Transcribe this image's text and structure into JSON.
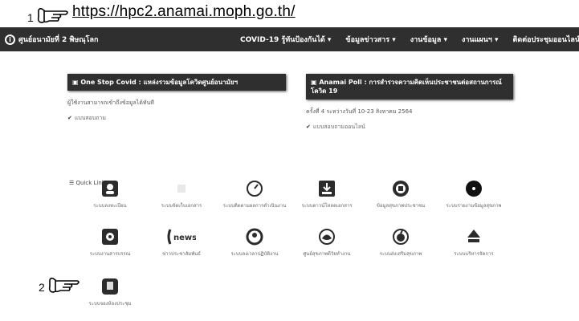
{
  "annotations": {
    "callout1": "1",
    "callout2": "2",
    "url": "https://hpc2.anamai.moph.go.th/"
  },
  "navbar": {
    "brand": "ศูนย์อนามัยที่ 2 พิษณุโลก",
    "menu": [
      "COVID-19 รู้ทันป้องกันได้ ▾",
      "ข้อมูลข่าวสาร ▾",
      "งานข้อมูล ▾",
      "งานแผนฯ ▾",
      "ติดต่อประชุมออนไลน์"
    ]
  },
  "panel_left": {
    "heading": "▣ One Stop Covid : แหล่งรวมข้อมูลโควิดศูนย์อนามัยฯ",
    "line": "ผู้ใช้งานสามารถเข้าถึงข้อมูลได้ทันที",
    "link": "แบบสอบถาม"
  },
  "panel_right": {
    "heading": "▣ Anamai Poll : การสำรวจความคิดเห็นประชาชนต่อสถานการณ์โควิด 19",
    "line": "ครั้งที่ 4 ระหว่างวันที่ 10-23 สิงหาคม 2564",
    "link": "แบบสอบถามออนไลน์"
  },
  "quicklink_title": "☰ Quick Link",
  "tiles": [
    {
      "label": "ระบบลงทะเบียน",
      "icon": "user-icon",
      "color": "#2b2b2b"
    },
    {
      "label": "ระบบจัดเก็บเอกสาร",
      "icon": "blank-icon",
      "color": "#cccccc"
    },
    {
      "label": "ระบบติดตามผลการดำเนินงาน",
      "icon": "gauge-icon",
      "color": "#2b2b2b"
    },
    {
      "label": "ระบบดาวน์โหลดเอกสาร",
      "icon": "download-icon",
      "color": "#2b2b2b"
    },
    {
      "label": "ข้อมูลสุขภาพประชาชน",
      "icon": "chat-icon",
      "color": "#2b2b2b"
    },
    {
      "label": "ระบบรายงานข้อมูลสุขภาพ",
      "icon": "disc-icon",
      "color": "#111111"
    },
    {
      "label": "ระบบงานสารบรรณ",
      "icon": "gear-box-icon",
      "color": "#2b2b2b"
    },
    {
      "label": "ข่าวประชาสัมพันธ์",
      "icon": "news-icon",
      "color": "#2b2b2b"
    },
    {
      "label": "ระบบลงเวลาปฏิบัติงาน",
      "icon": "face-icon",
      "color": "#2b2b2b"
    },
    {
      "label": "ศูนย์สุขภาพดีวัยทำงาน",
      "icon": "lotus-icon",
      "color": "#2b2b2b"
    },
    {
      "label": "ระบบส่งเสริมสุขภาพ",
      "icon": "fruit-icon",
      "color": "#2b2b2b"
    },
    {
      "label": "ระบบบริหารจัดการ",
      "icon": "logo-icon",
      "color": "#2b2b2b"
    },
    {
      "label": "ระบบจองห้องประชุม",
      "icon": "book-icon",
      "color": "#2b2b2b"
    }
  ]
}
